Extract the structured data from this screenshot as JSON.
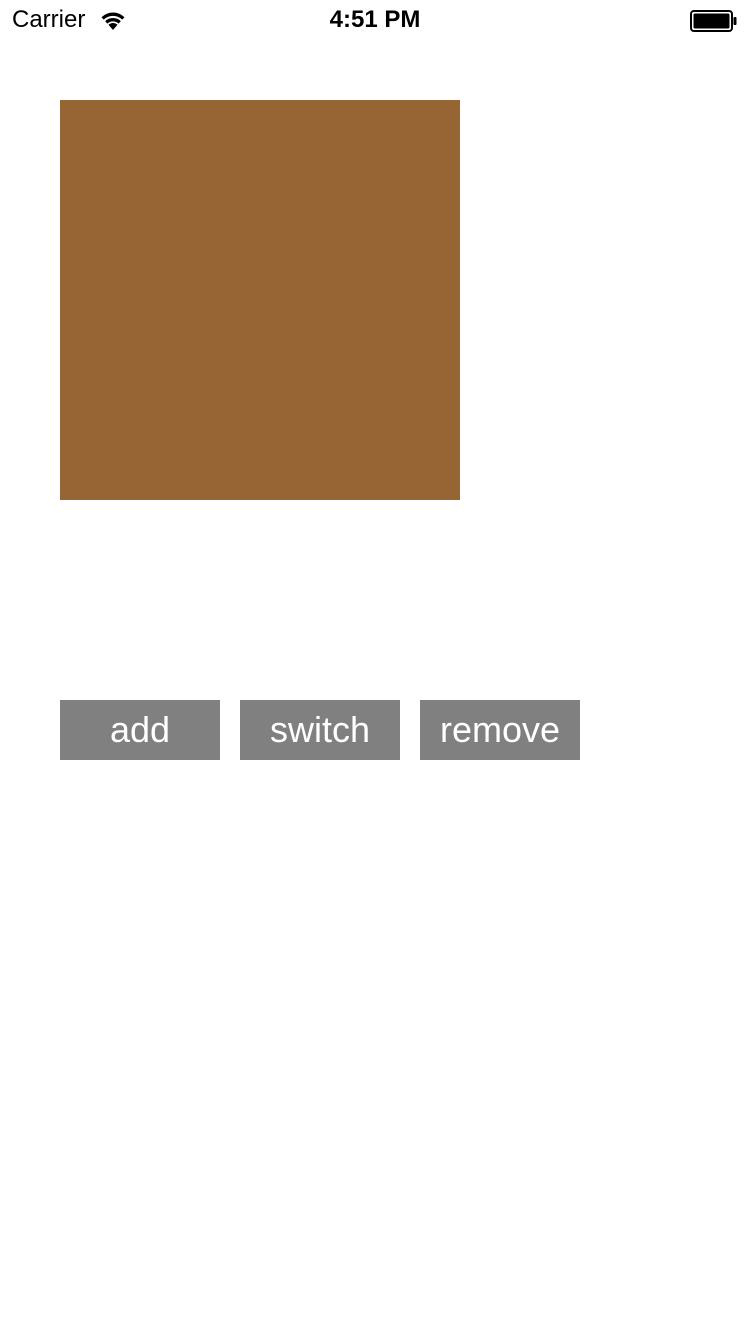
{
  "status_bar": {
    "carrier": "Carrier",
    "time": "4:51 PM",
    "wifi_icon": "wifi-icon",
    "battery_icon": "battery-icon",
    "battery_level": 1.0
  },
  "main": {
    "box_color": "#976434",
    "buttons": {
      "add_label": "add",
      "switch_label": "switch",
      "remove_label": "remove",
      "background_color": "#808080",
      "text_color": "#ffffff"
    }
  }
}
